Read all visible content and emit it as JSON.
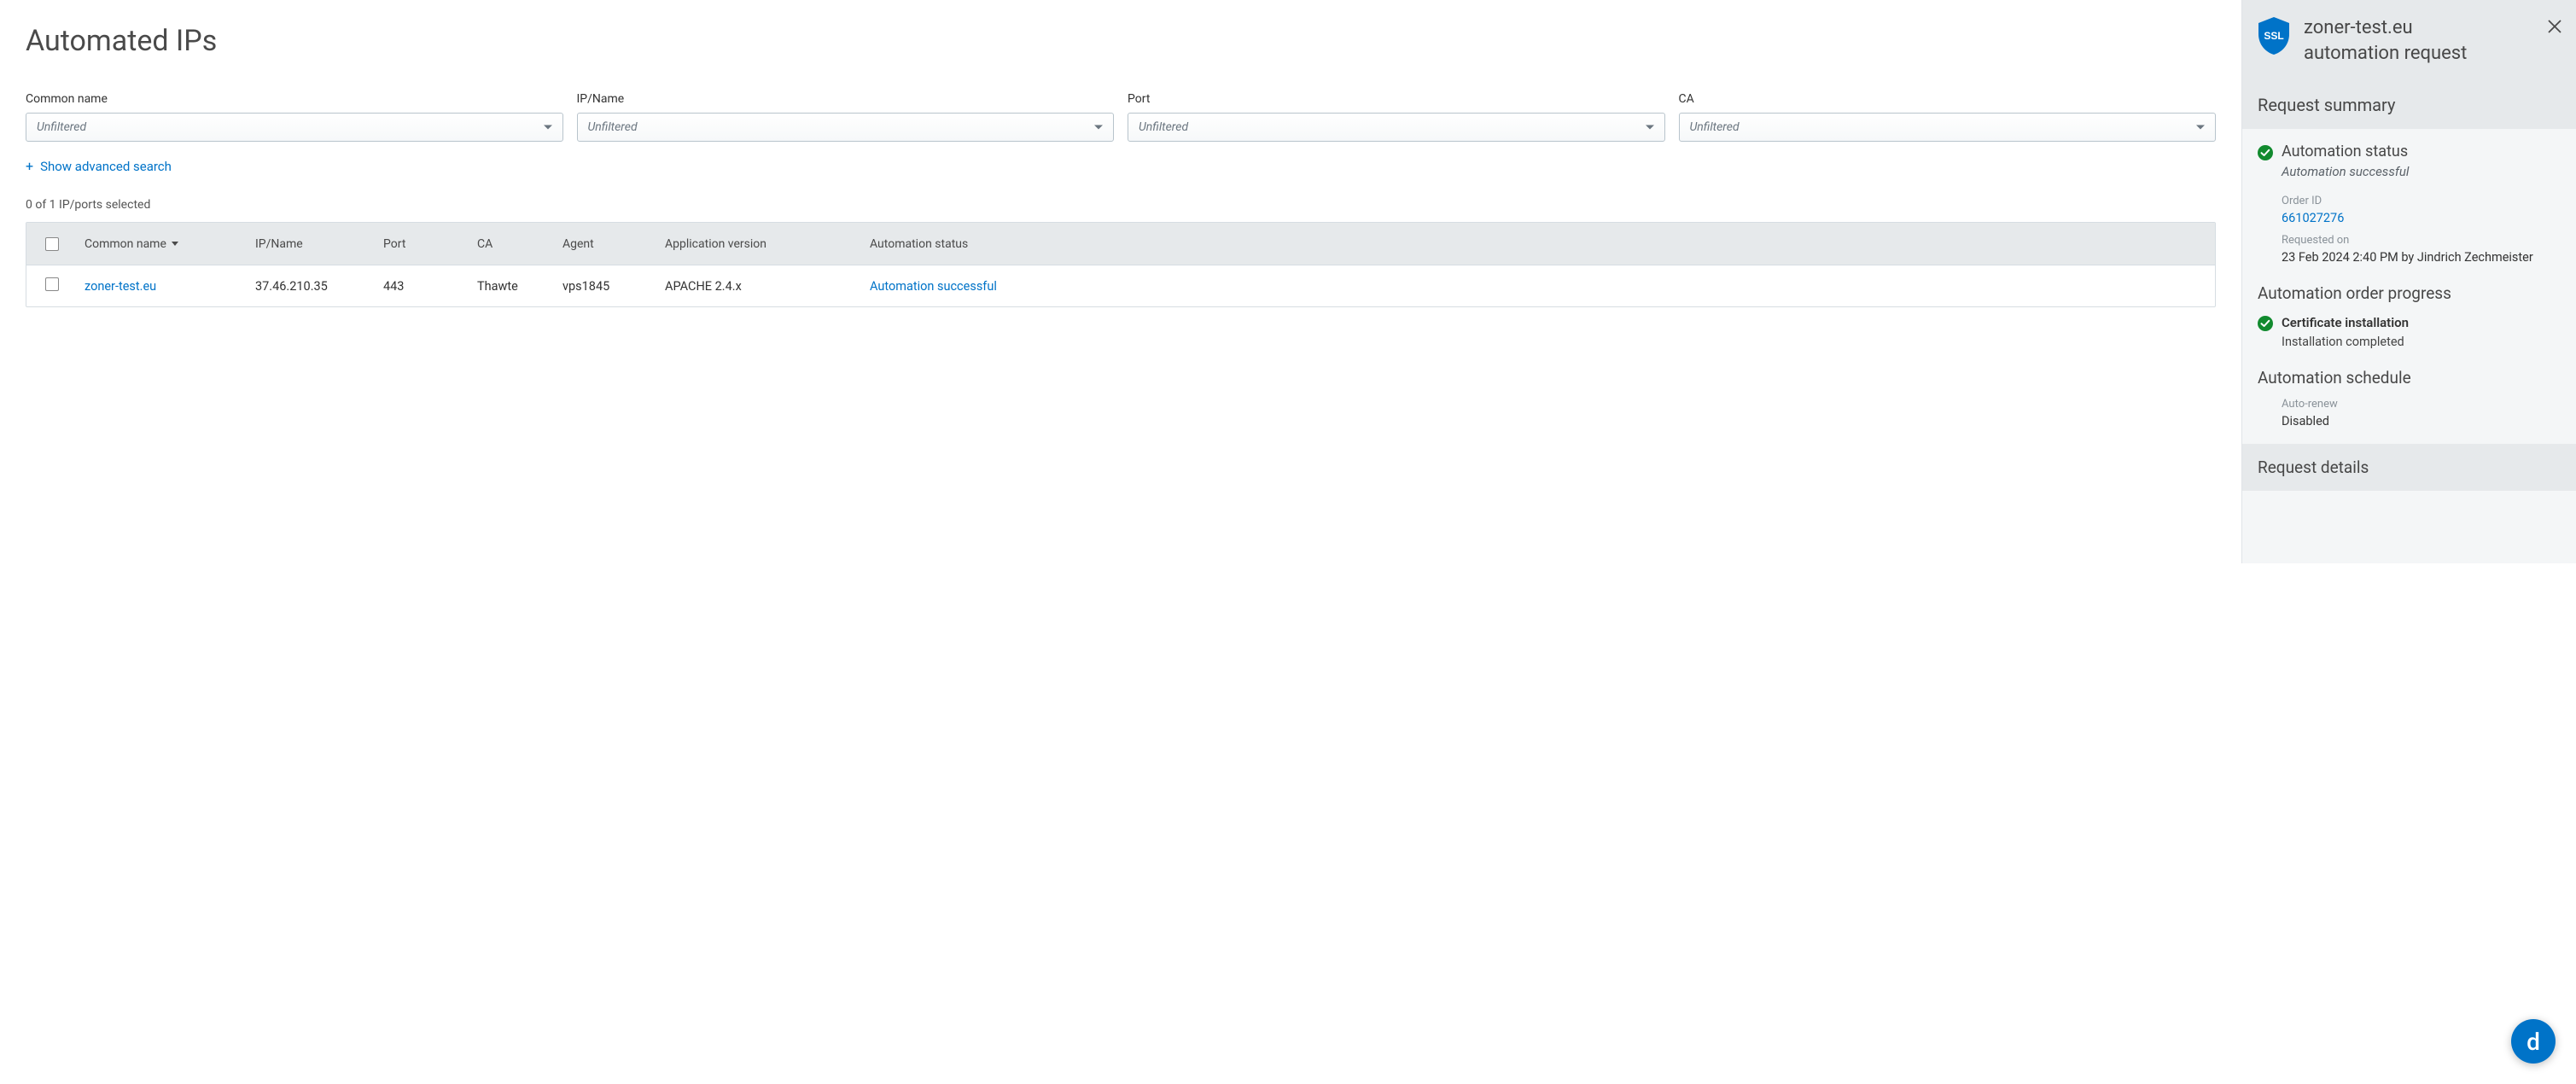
{
  "page": {
    "title": "Automated IPs",
    "selection_text": "0 of 1 IP/ports selected",
    "advanced_search": "Show advanced search"
  },
  "filters": [
    {
      "label": "Common name",
      "placeholder": "Unfiltered"
    },
    {
      "label": "IP/Name",
      "placeholder": "Unfiltered"
    },
    {
      "label": "Port",
      "placeholder": "Unfiltered"
    },
    {
      "label": "CA",
      "placeholder": "Unfiltered"
    }
  ],
  "table": {
    "headers": {
      "common_name": "Common name",
      "ip_name": "IP/Name",
      "port": "Port",
      "ca": "CA",
      "agent": "Agent",
      "app_version": "Application version",
      "auto_status": "Automation status"
    },
    "rows": [
      {
        "common_name": "zoner-test.eu",
        "ip_name": "37.46.210.35",
        "port": "443",
        "ca": "Thawte",
        "agent": "vps1845",
        "app_version": "APACHE 2.4.x",
        "auto_status": "Automation successful"
      }
    ]
  },
  "panel": {
    "title_line1": "zoner-test.eu",
    "title_line2": "automation request",
    "summary_heading": "Request summary",
    "status_title": "Automation status",
    "status_sub": "Automation successful",
    "order_id_label": "Order ID",
    "order_id": "661027276",
    "requested_on_label": "Requested on",
    "requested_on": "23 Feb 2024 2:40 PM by Jindrich Zechmeister",
    "progress_heading": "Automation order progress",
    "step_title": "Certificate installation",
    "step_sub": "Installation completed",
    "schedule_heading": "Automation schedule",
    "autorenew_label": "Auto-renew",
    "autorenew_value": "Disabled",
    "details_heading": "Request details"
  },
  "badge": {
    "letter": "d"
  }
}
